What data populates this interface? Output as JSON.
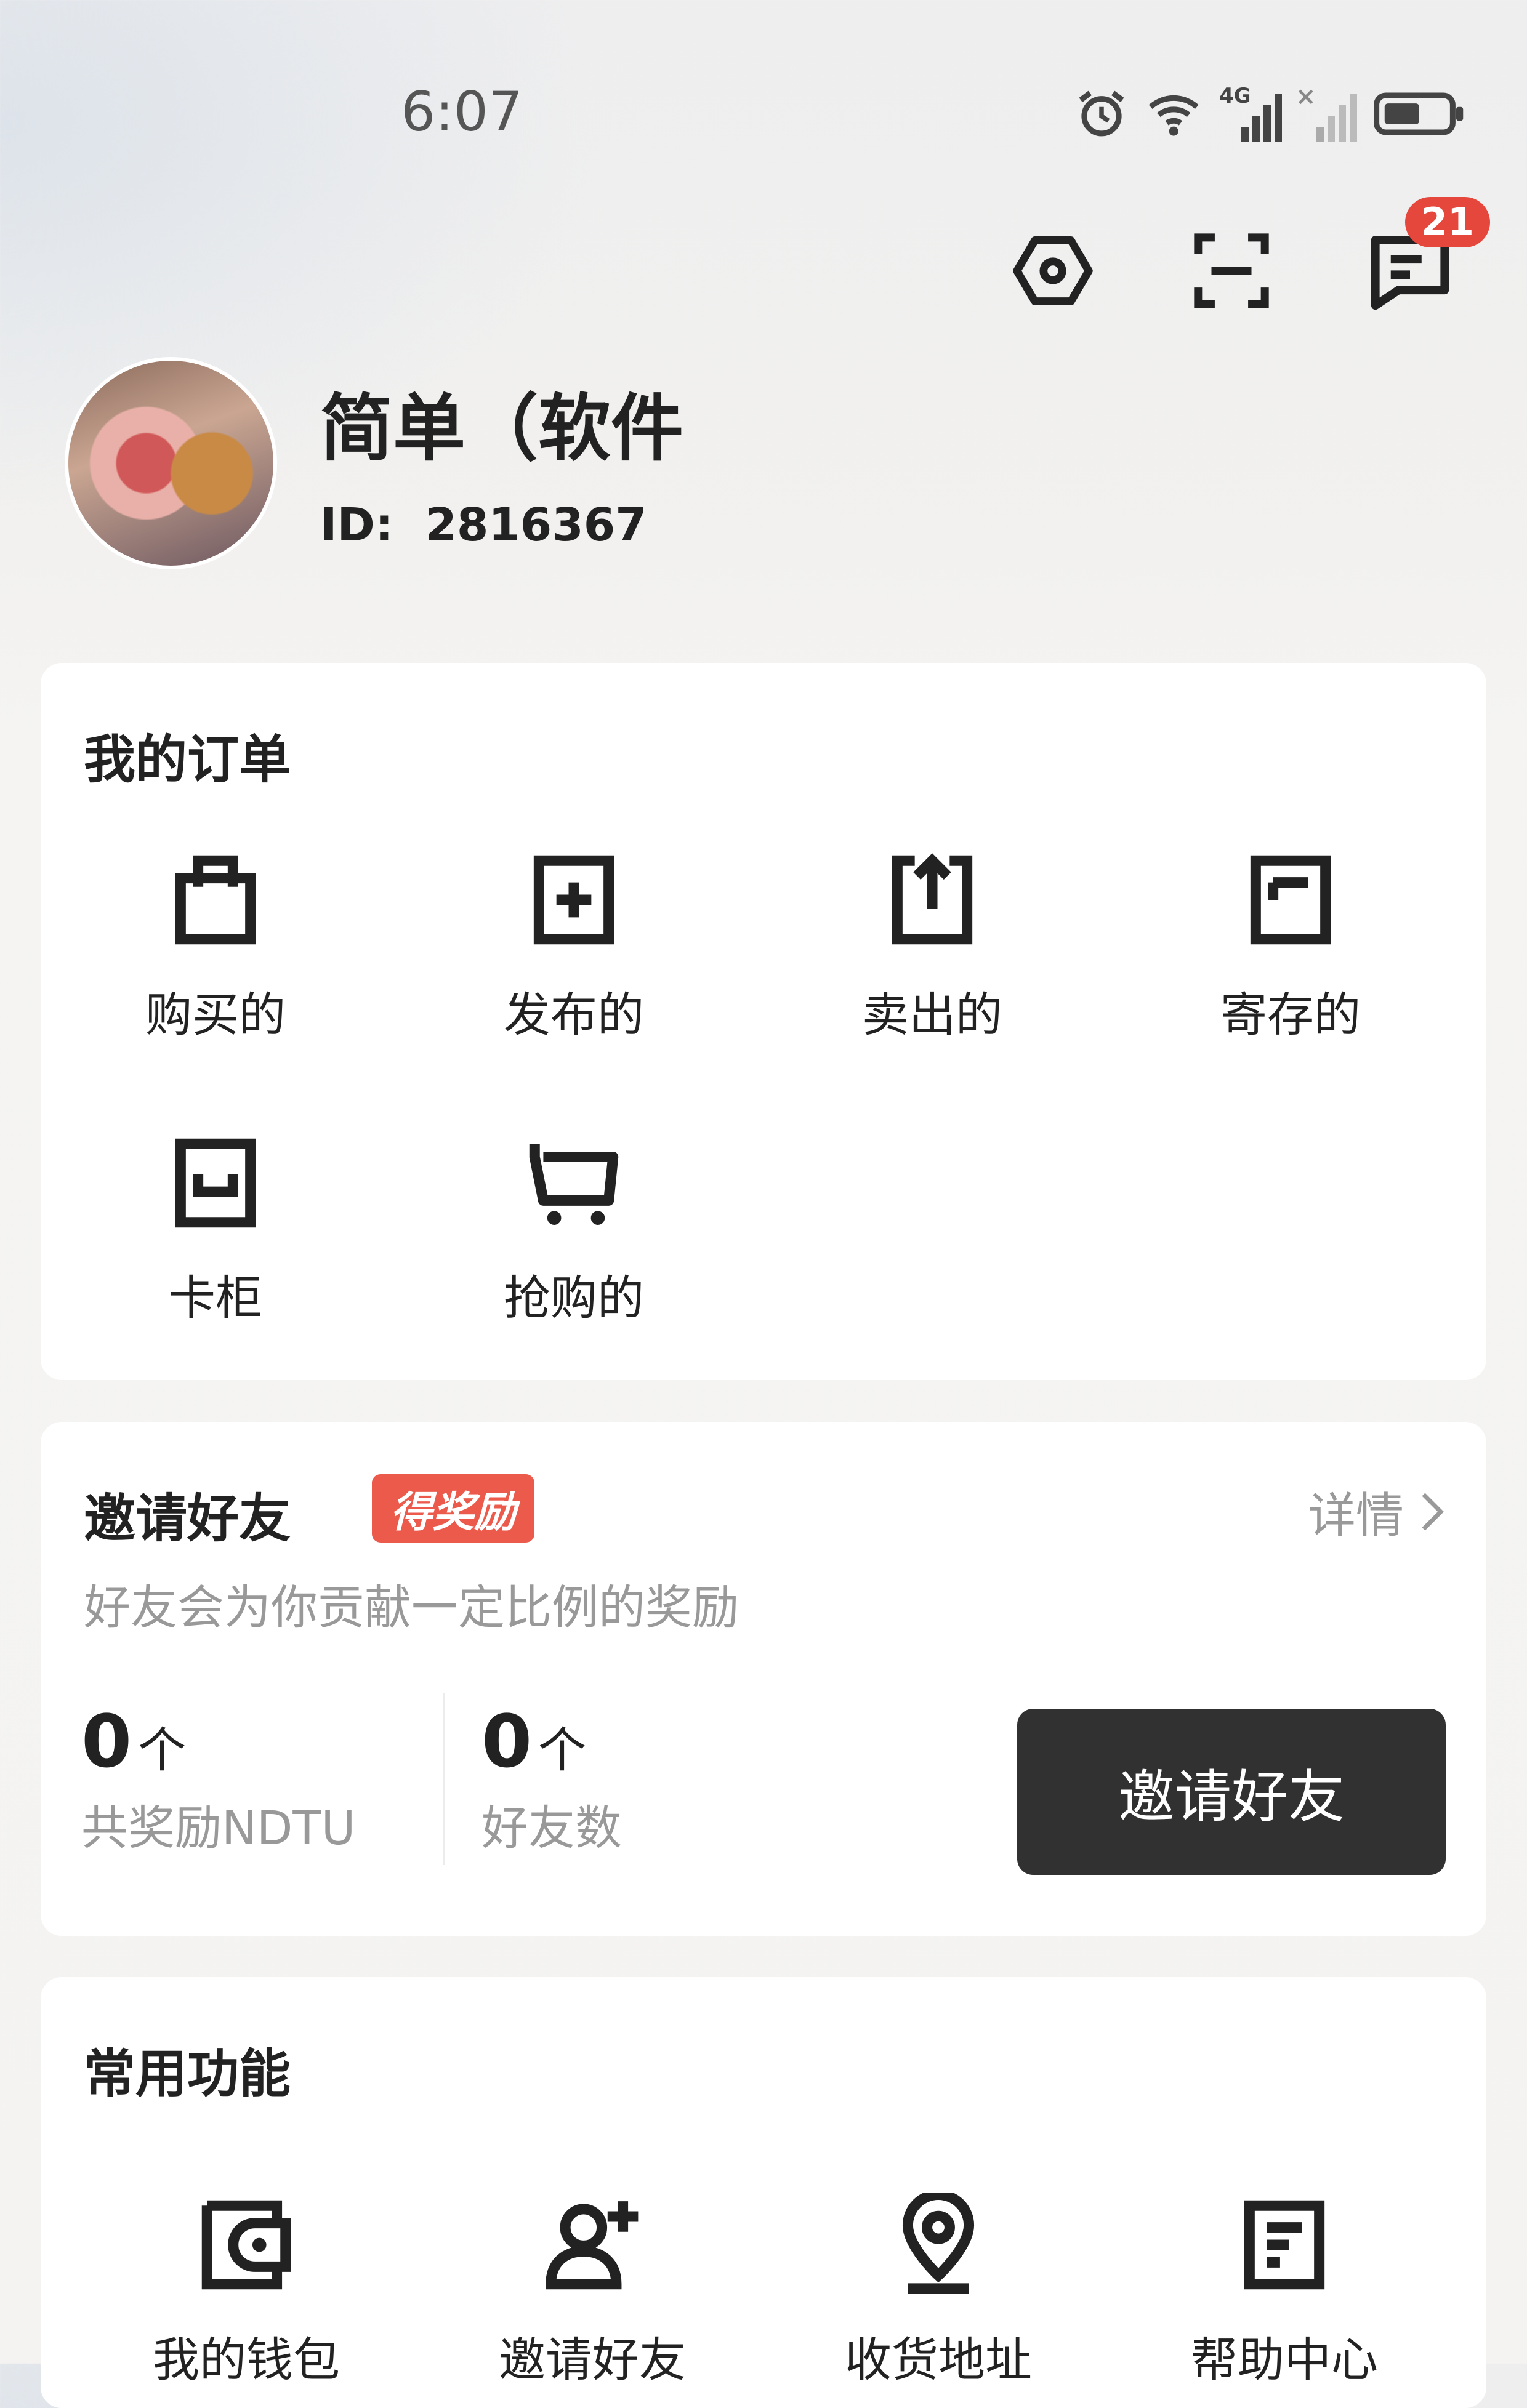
{
  "status_bar": {
    "time": "6:07",
    "network": "4G"
  },
  "header": {
    "message_badge": "21"
  },
  "profile": {
    "name": "简单（软件",
    "id_label": "ID:",
    "id_value": "2816367"
  },
  "orders": {
    "title": "我的订单",
    "items": [
      {
        "label": "购买的",
        "icon": "shopping-bag-icon"
      },
      {
        "label": "发布的",
        "icon": "publish-icon"
      },
      {
        "label": "卖出的",
        "icon": "sold-icon"
      },
      {
        "label": "寄存的",
        "icon": "storage-icon"
      },
      {
        "label": "卡柜",
        "icon": "card-cabinet-icon"
      },
      {
        "label": "抢购的",
        "icon": "cart-icon"
      }
    ]
  },
  "invite": {
    "title": "邀请好友",
    "tag": "得奖励",
    "details": "详情",
    "subtitle": "好友会为你贡献一定比例的奖励",
    "stats": [
      {
        "value": "0",
        "unit": "个",
        "label": "共奖励NDTU"
      },
      {
        "value": "0",
        "unit": "个",
        "label": "好友数"
      }
    ],
    "button": "邀请好友"
  },
  "common": {
    "title": "常用功能",
    "items": [
      {
        "label": "我的钱包",
        "icon": "wallet-icon"
      },
      {
        "label": "邀请好友",
        "icon": "add-friend-icon"
      },
      {
        "label": "收货地址",
        "icon": "location-icon"
      },
      {
        "label": "帮助中心",
        "icon": "help-center-icon"
      }
    ]
  }
}
